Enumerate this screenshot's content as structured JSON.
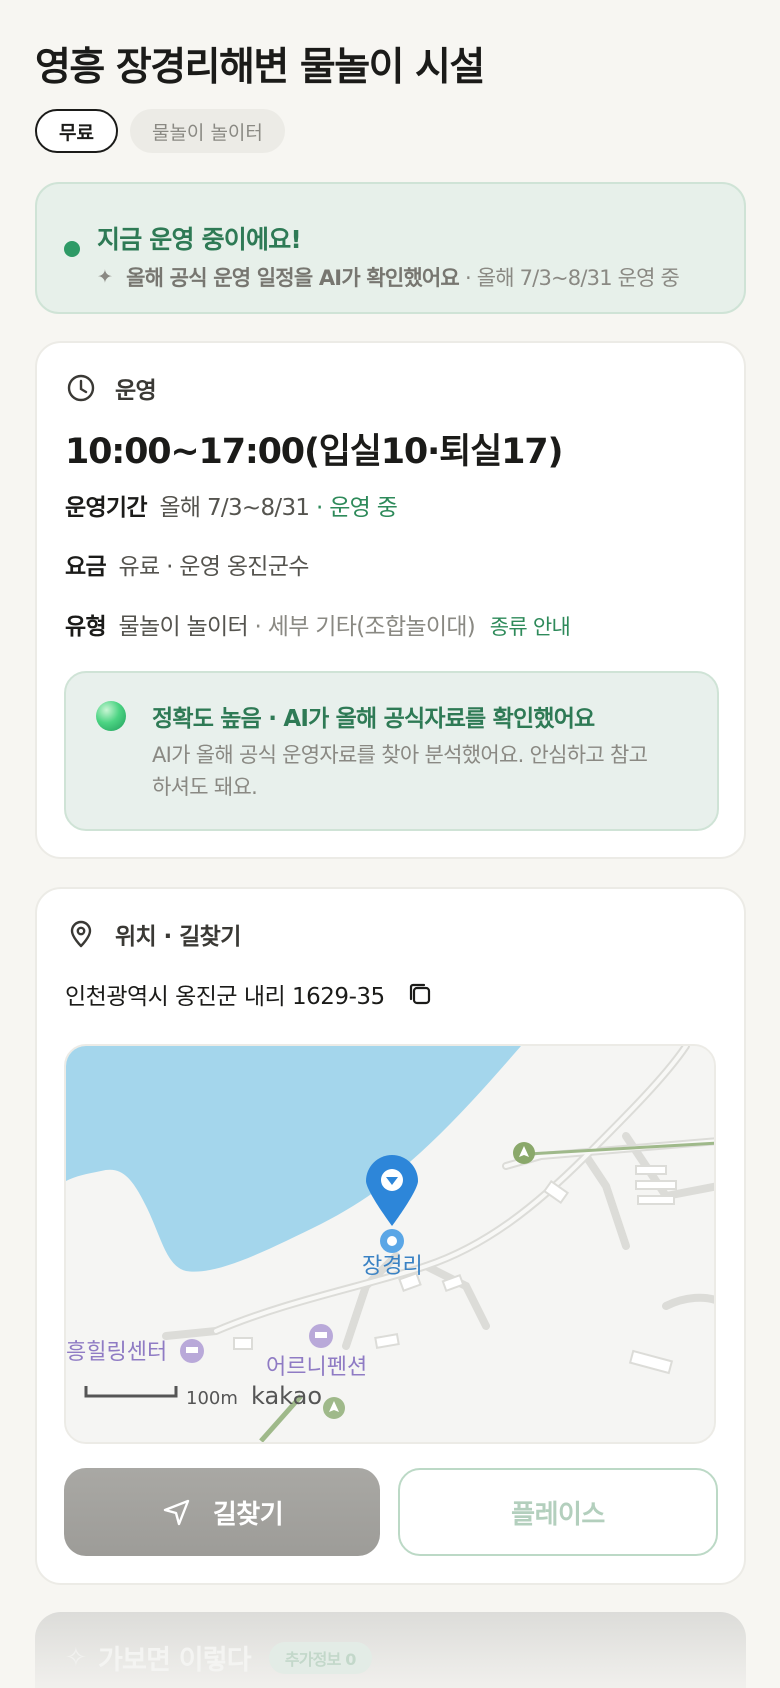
{
  "title": "영흥 장경리해변 물놀이 시설",
  "tags": {
    "price": "무료",
    "type": "물놀이 놀이터"
  },
  "status": {
    "title": "지금 운영 중이에요!",
    "ai_note": "올해 공식 운영 일정을 AI가 확인했어요",
    "period": "· 올해 7/3~8/31 운영 중"
  },
  "operation": {
    "section_title": "운영",
    "hours": "10:00~17:00(입실10·퇴실17)",
    "period_key": "운영기간",
    "period_value": "올해 7/3~8/31",
    "period_status": "· 운영 중",
    "fee_key": "요금",
    "fee_value": "유료 · 운영 옹진군수",
    "type_key": "유형",
    "type_value": "물놀이 놀이터",
    "type_detail": "· 세부 기타(조합놀이대)",
    "type_guide": "종류 안내",
    "accuracy_title": "정확도 높음 · AI가 올해 공식자료를 확인했어요",
    "accuracy_desc": "AI가 올해 공식 운영자료를 찾아 분석했어요. 안심하고 참고하셔도 돼요."
  },
  "location": {
    "section_title": "위치 · 길찾기",
    "address": "인천광역시 옹진군 내리 1629-35",
    "map": {
      "marker_label": "장경리",
      "poi_1": "흥힐링센터",
      "poi_2": "어르니펜션",
      "scale": "100m",
      "provider": "kakao"
    },
    "route_button": "길찾기",
    "place_button": "플레이스"
  },
  "next_section": {
    "title": "가보면 이렇다",
    "badge": "추가정보 0"
  },
  "colors": {
    "accent_green": "#2e8a5a",
    "status_bg": "#e7f0ea",
    "map_water": "#a4d6ec",
    "marker_blue": "#2d86d9"
  }
}
